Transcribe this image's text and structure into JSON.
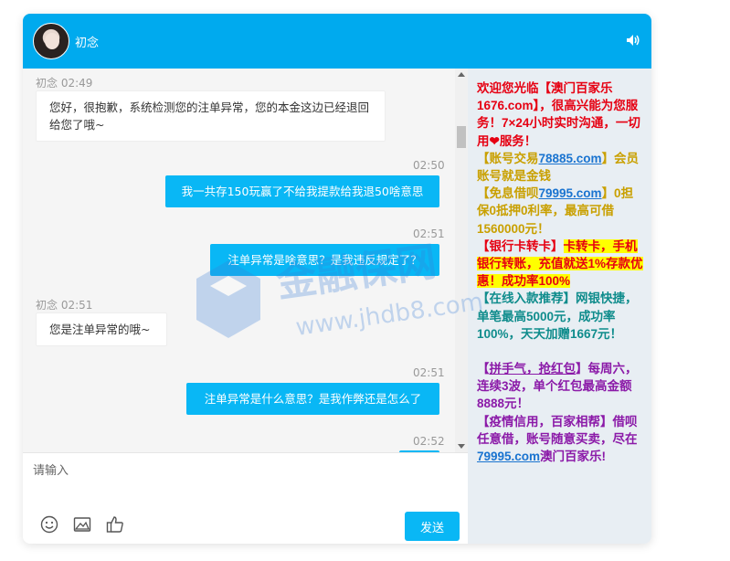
{
  "header": {
    "title": "初念",
    "avatar_icon": "avatar-photo",
    "sound_icon": "speaker-icon"
  },
  "messages": [
    {
      "type": "in",
      "meta": "初念 02:49",
      "text": "您好，很抱歉，系统检测您的注单异常，您的本金这边已经退回给您了哦~"
    },
    {
      "type": "out",
      "meta": "02:50",
      "text": "我一共存150玩赢了不给我提款给我退50啥意思"
    },
    {
      "type": "out",
      "meta": "02:51",
      "text": "注单异常是啥意思？是我违反规定了？"
    },
    {
      "type": "in",
      "meta": "初念 02:51",
      "text": "您是注单异常的哦~"
    },
    {
      "type": "out",
      "meta": "02:51",
      "text": "注单异常是什么意思？是我作弊还是怎么了"
    },
    {
      "type": "out",
      "meta": "02:52",
      "text": ""
    }
  ],
  "input": {
    "placeholder": "请输入",
    "send_label": "发送",
    "tools": [
      "smile-icon",
      "image-icon",
      "thumbs-up-icon"
    ]
  },
  "sidebar": {
    "welcome_1": "欢迎您光临【澳门百家乐1676.com】，很高兴能为您服务！7×24小时实时沟通，一切用",
    "welcome_heart": "❤",
    "welcome_2": "服务！",
    "account_pre": "【账号交易",
    "account_link": "78885.com",
    "account_post": "】会员账号就是金钱",
    "loan_pre": "【免息借呗",
    "loan_link": "79995.com",
    "loan_post": "】0担保0抵押0利率，最高可借1560000元！",
    "bank_tag": "【银行卡转卡】",
    "bank_hl": "卡转卡，手机银行转账，充值就送1%存款优惠！成功率100%",
    "online": "【在线入款推荐】网银快捷，单笔最高5000元，成功率100%，天天加赠1667元！",
    "lucky_pre": "【",
    "lucky_link": "拼手气，抢红包",
    "lucky_post": "】每周六，连续3波，单个红包最高金额8888元！",
    "epidemic_pre": "【疫情信用，百家相帮】借呗任意借，账号随意买卖，尽在",
    "epidemic_link": "79995.com",
    "epidemic_post": "澳门百家乐!"
  },
  "watermark": {
    "url": "www.jhdb8.com",
    "logo_text": "金融保网"
  },
  "colors": {
    "accent": "#09b7f5",
    "header": "#00aaee",
    "red": "#e60012",
    "gold": "#c9a000",
    "teal": "#0f8c8c",
    "purple": "#8b1aa8",
    "link": "#1a74d0",
    "highlight": "#ffff00"
  }
}
